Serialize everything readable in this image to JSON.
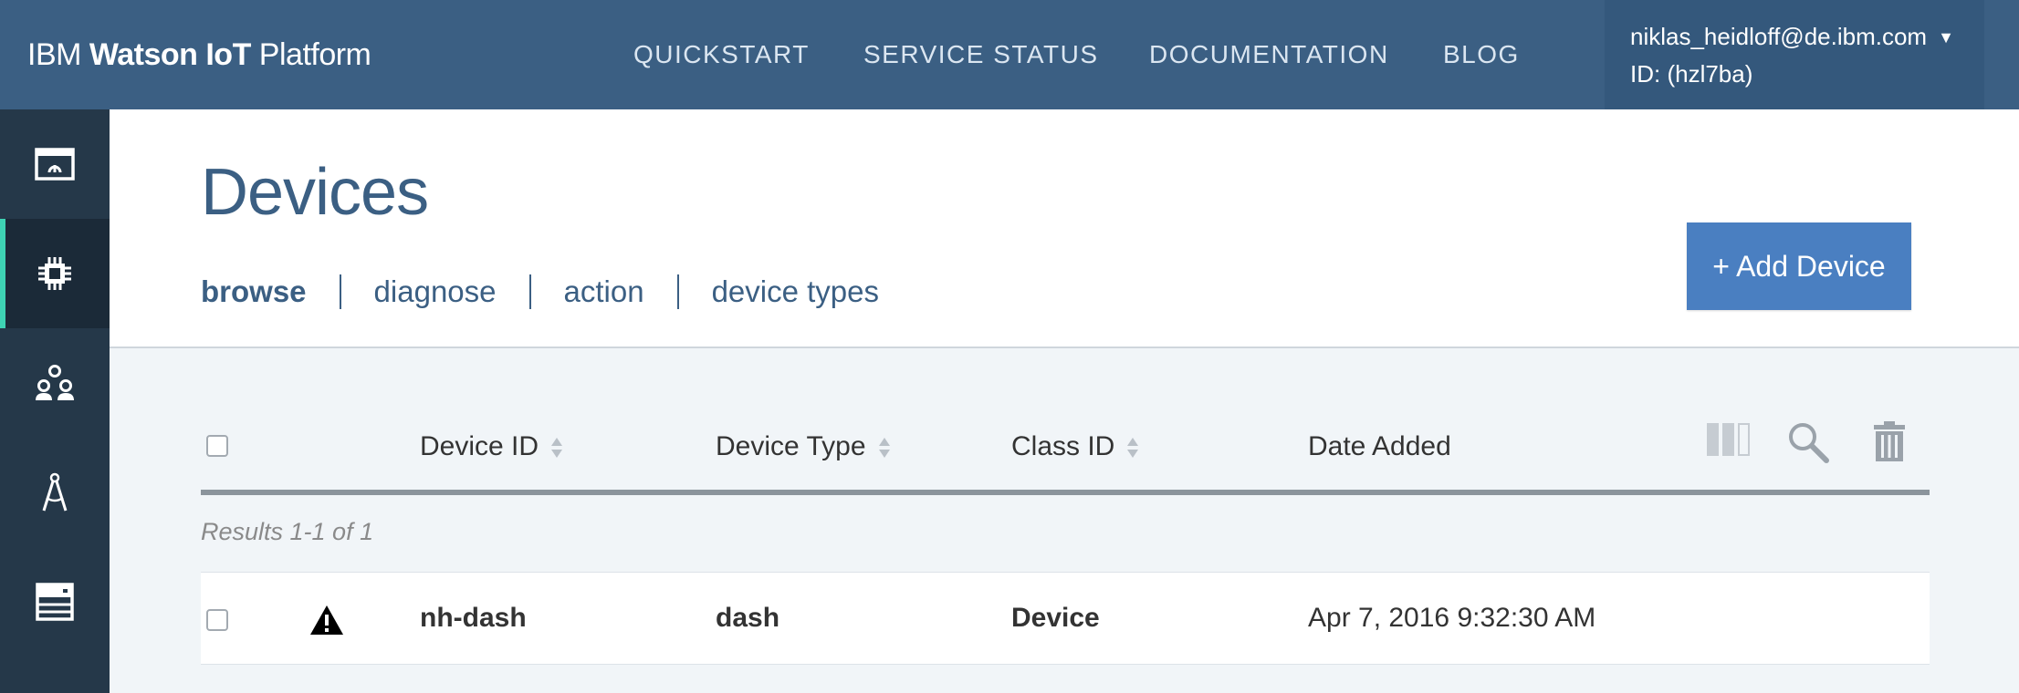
{
  "app": {
    "brand_prefix": "IBM",
    "brand_bold": "Watson IoT",
    "brand_suffix": "Platform"
  },
  "nav": {
    "items": [
      "QUICKSTART",
      "SERVICE STATUS",
      "DOCUMENTATION",
      "BLOG"
    ]
  },
  "account": {
    "email": "niklas_heidloff@de.ibm.com",
    "id_label": "ID: (hzl7ba)",
    "caret_icon": "caret-down-icon"
  },
  "sidebar": {
    "items": [
      {
        "name": "dashboard",
        "icon": "dashboard-icon",
        "active": false
      },
      {
        "name": "devices",
        "icon": "chip-icon",
        "active": true
      },
      {
        "name": "members",
        "icon": "members-icon",
        "active": false
      },
      {
        "name": "rules",
        "icon": "compass-icon",
        "active": false
      },
      {
        "name": "extensions",
        "icon": "server-icon",
        "active": false
      }
    ]
  },
  "page": {
    "title": "Devices",
    "tabs": [
      {
        "label": "browse",
        "active": true
      },
      {
        "label": "diagnose",
        "active": false
      },
      {
        "label": "action",
        "active": false
      },
      {
        "label": "device types",
        "active": false
      }
    ],
    "add_button": "+ Add Device"
  },
  "table": {
    "columns": [
      "Device ID",
      "Device Type",
      "Class ID",
      "Date Added"
    ],
    "results_text": "Results 1-1 of 1",
    "tools": [
      "columns-icon",
      "search-icon",
      "trash-icon"
    ],
    "rows": [
      {
        "status_icon": "warning-icon",
        "device_id": "nh-dash",
        "device_type": "dash",
        "class_id": "Device",
        "date_added": "Apr 7, 2016 9:32:30 AM"
      }
    ]
  },
  "colors": {
    "topbar": "#3b5f83",
    "sidebar": "#253849",
    "sidebar_active_accent": "#3ed3b4",
    "primary_button": "#4a7fc1",
    "title_text": "#3b5f83"
  }
}
